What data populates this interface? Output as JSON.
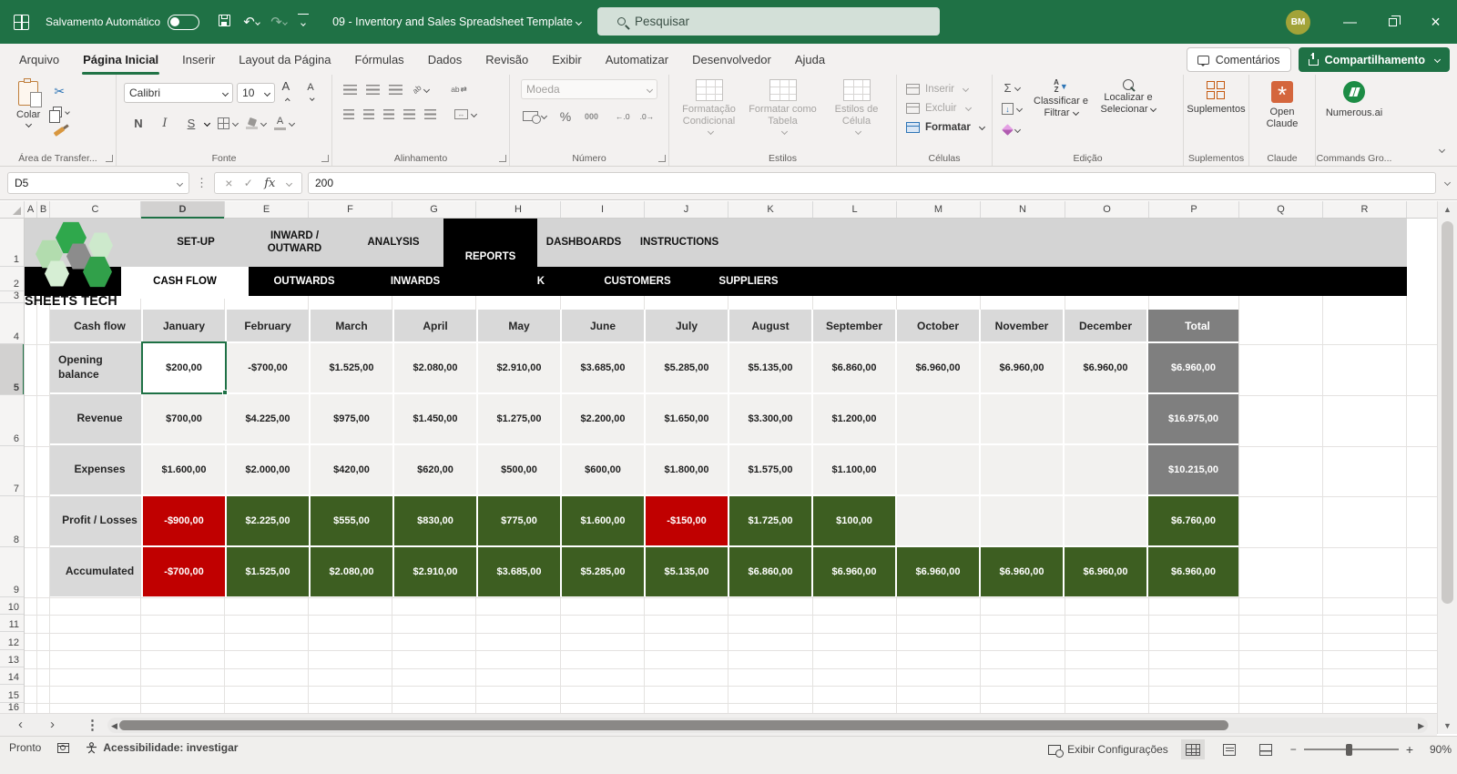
{
  "titlebar": {
    "autosave_label": "Salvamento Automático",
    "title": "09 - Inventory and Sales Spreadsheet Template",
    "search_placeholder": "Pesquisar",
    "avatar_initials": "BM"
  },
  "icons": {
    "cut": "✂",
    "sum": "Σ",
    "check": "✓",
    "close_x": "×",
    "undo": "↶",
    "redo": "↷",
    "dots": "⋮",
    "prev": "‹",
    "next": "›",
    "left": "◀",
    "right": "▶",
    "up": "▲",
    "down": "▼",
    "minus": "−",
    "plus": "+",
    "minimize": "—",
    "percent": "%",
    "thousands": "000",
    "dec_left": "←.0",
    "dec_right": ".0→",
    "merge_arrows": "↔",
    "wrap_mark": "ab",
    "orient_mark": "ab",
    "fill_arrow": "↓",
    "az_a": "A",
    "az_z": "Z",
    "funnel": "▼",
    "star": "*"
  },
  "ribbon_tabs": [
    "Arquivo",
    "Página Inicial",
    "Inserir",
    "Layout da Página",
    "Fórmulas",
    "Dados",
    "Revisão",
    "Exibir",
    "Automatizar",
    "Desenvolvedor",
    "Ajuda"
  ],
  "active_ribbon_tab": "Página Inicial",
  "ribbon_right": {
    "comments": "Comentários",
    "share": "Compartilhamento"
  },
  "ribbon": {
    "paste": "Colar",
    "clipboard_group": "Área de Transfer...",
    "font_name": "Calibri",
    "font_size": "10",
    "bold": "N",
    "italic": "I",
    "underline": "S",
    "font_group": "Fonte",
    "alignment_group": "Alinhamento",
    "number_format": "Moeda",
    "number_group": "Número",
    "cond_format": "Formatação Condicional",
    "format_table": "Formatar como Tabela",
    "cell_styles": "Estilos de Célula",
    "styles_group": "Estilos",
    "insert": "Inserir",
    "delete": "Excluir",
    "format": "Formatar",
    "cells_group": "Células",
    "sort_filter": "Classificar e Filtrar",
    "find_select": "Localizar e Selecionar",
    "editing_group": "Edição",
    "addins": "Suplementos",
    "addins_group": "Suplementos",
    "open_claude": "Open Claude",
    "claude_group": "Claude",
    "numerous": "Numerous.ai",
    "commands_group": "Commands Gro..."
  },
  "formula_bar": {
    "name_box": "D5",
    "fx": "fx",
    "value": "200"
  },
  "grid": {
    "columns": [
      "A",
      "B",
      "C",
      "D",
      "E",
      "F",
      "G",
      "H",
      "I",
      "J",
      "K",
      "L",
      "M",
      "N",
      "O",
      "P",
      "Q",
      "R"
    ],
    "selected_column": "D",
    "rows": [
      "1",
      "2",
      "3",
      "4",
      "5",
      "6",
      "7",
      "8",
      "9",
      "10",
      "11",
      "12",
      "13",
      "14",
      "15",
      "16"
    ],
    "selected_row": "5"
  },
  "sheet_nav": {
    "tabs": [
      "SET-UP",
      "INWARD / OUTWARD",
      "ANALYSIS",
      "REPORTS",
      "DASHBOARDS",
      "INSTRUCTIONS"
    ],
    "active": "REPORTS",
    "subtabs": [
      "CASH FLOW",
      "OUTWARDS",
      "INWARDS",
      "STOCK",
      "CUSTOMERS",
      "SUPPLIERS"
    ],
    "active_subtab": "CASH FLOW",
    "logo_text": "SHEETS TECH"
  },
  "cashflow_table": {
    "palette": {
      "plain": "#f2f1ef",
      "red": "#c00000",
      "green": "#3d5e21",
      "gray": "#7f7f7f",
      "label": "#d9d9d9",
      "selected_bg": "#ffffff"
    },
    "columns": [
      "Cash flow",
      "January",
      "February",
      "March",
      "April",
      "May",
      "June",
      "July",
      "August",
      "September",
      "October",
      "November",
      "December",
      "Total"
    ],
    "rows": [
      {
        "label": "Opening balance",
        "cells": [
          {
            "v": "$200,00",
            "s": "sel"
          },
          {
            "v": "-$700,00",
            "s": "plain"
          },
          {
            "v": "$1.525,00",
            "s": "plain"
          },
          {
            "v": "$2.080,00",
            "s": "plain"
          },
          {
            "v": "$2.910,00",
            "s": "plain"
          },
          {
            "v": "$3.685,00",
            "s": "plain"
          },
          {
            "v": "$5.285,00",
            "s": "plain"
          },
          {
            "v": "$5.135,00",
            "s": "plain"
          },
          {
            "v": "$6.860,00",
            "s": "plain"
          },
          {
            "v": "$6.960,00",
            "s": "plain"
          },
          {
            "v": "$6.960,00",
            "s": "plain"
          },
          {
            "v": "$6.960,00",
            "s": "plain"
          }
        ],
        "total": {
          "v": "$6.960,00",
          "s": "gray"
        }
      },
      {
        "label": "Revenue",
        "cells": [
          {
            "v": "$700,00",
            "s": "plain"
          },
          {
            "v": "$4.225,00",
            "s": "plain"
          },
          {
            "v": "$975,00",
            "s": "plain"
          },
          {
            "v": "$1.450,00",
            "s": "plain"
          },
          {
            "v": "$1.275,00",
            "s": "plain"
          },
          {
            "v": "$2.200,00",
            "s": "plain"
          },
          {
            "v": "$1.650,00",
            "s": "plain"
          },
          {
            "v": "$3.300,00",
            "s": "plain"
          },
          {
            "v": "$1.200,00",
            "s": "plain"
          },
          {
            "v": "",
            "s": "plain"
          },
          {
            "v": "",
            "s": "plain"
          },
          {
            "v": "",
            "s": "plain"
          }
        ],
        "total": {
          "v": "$16.975,00",
          "s": "gray"
        }
      },
      {
        "label": "Expenses",
        "cells": [
          {
            "v": "$1.600,00",
            "s": "plain"
          },
          {
            "v": "$2.000,00",
            "s": "plain"
          },
          {
            "v": "$420,00",
            "s": "plain"
          },
          {
            "v": "$620,00",
            "s": "plain"
          },
          {
            "v": "$500,00",
            "s": "plain"
          },
          {
            "v": "$600,00",
            "s": "plain"
          },
          {
            "v": "$1.800,00",
            "s": "plain"
          },
          {
            "v": "$1.575,00",
            "s": "plain"
          },
          {
            "v": "$1.100,00",
            "s": "plain"
          },
          {
            "v": "",
            "s": "plain"
          },
          {
            "v": "",
            "s": "plain"
          },
          {
            "v": "",
            "s": "plain"
          }
        ],
        "total": {
          "v": "$10.215,00",
          "s": "gray"
        }
      },
      {
        "label": "Profit / Losses",
        "cells": [
          {
            "v": "-$900,00",
            "s": "red"
          },
          {
            "v": "$2.225,00",
            "s": "green"
          },
          {
            "v": "$555,00",
            "s": "green"
          },
          {
            "v": "$830,00",
            "s": "green"
          },
          {
            "v": "$775,00",
            "s": "green"
          },
          {
            "v": "$1.600,00",
            "s": "green"
          },
          {
            "v": "-$150,00",
            "s": "red"
          },
          {
            "v": "$1.725,00",
            "s": "green"
          },
          {
            "v": "$100,00",
            "s": "green"
          },
          {
            "v": "",
            "s": "plain"
          },
          {
            "v": "",
            "s": "plain"
          },
          {
            "v": "",
            "s": "plain"
          }
        ],
        "total": {
          "v": "$6.760,00",
          "s": "green"
        }
      },
      {
        "label": "Accumulated",
        "cells": [
          {
            "v": "-$700,00",
            "s": "red"
          },
          {
            "v": "$1.525,00",
            "s": "green"
          },
          {
            "v": "$2.080,00",
            "s": "green"
          },
          {
            "v": "$2.910,00",
            "s": "green"
          },
          {
            "v": "$3.685,00",
            "s": "green"
          },
          {
            "v": "$5.285,00",
            "s": "green"
          },
          {
            "v": "$5.135,00",
            "s": "green"
          },
          {
            "v": "$6.860,00",
            "s": "green"
          },
          {
            "v": "$6.960,00",
            "s": "green"
          },
          {
            "v": "$6.960,00",
            "s": "green"
          },
          {
            "v": "$6.960,00",
            "s": "green"
          },
          {
            "v": "$6.960,00",
            "s": "green"
          }
        ],
        "total": {
          "v": "$6.960,00",
          "s": "green"
        }
      }
    ]
  },
  "status_bar": {
    "ready": "Pronto",
    "accessibility": "Acessibilidade: investigar",
    "view_settings": "Exibir Configurações",
    "zoom": "90%"
  },
  "colors": {
    "titlebar_green": "#1f7145",
    "accent_green": "#217346",
    "cell_red": "#c00000",
    "cell_green": "#3d5e21",
    "total_gray": "#7f7f7f",
    "header_gray": "#d9d9d9",
    "nav_gray": "#d4d4d4"
  }
}
